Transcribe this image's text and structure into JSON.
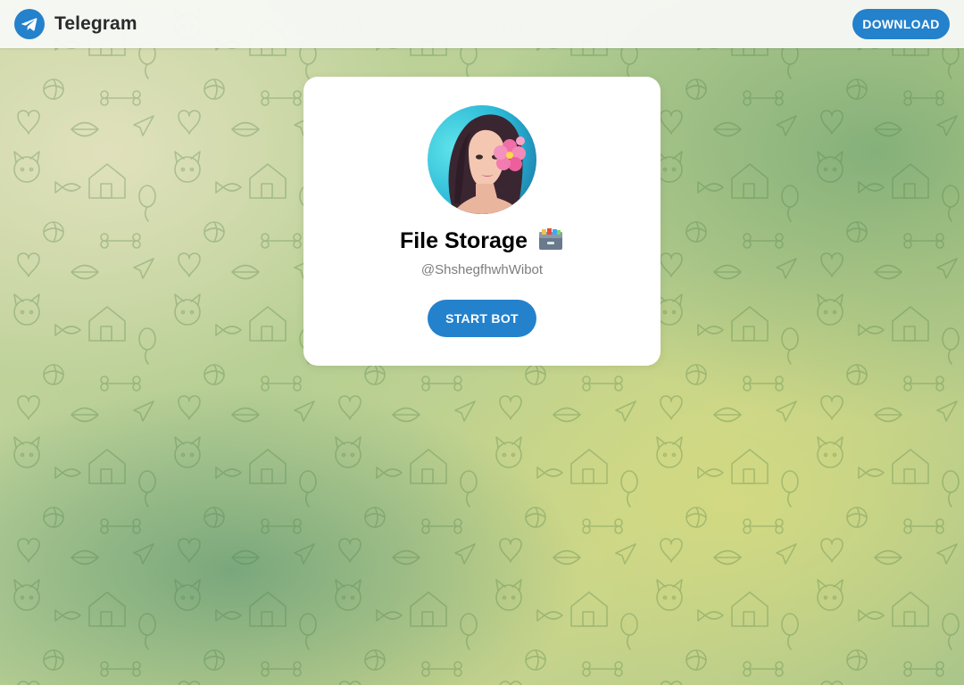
{
  "header": {
    "app_name": "Telegram",
    "download_label": "DOWNLOAD",
    "logo_icon": "telegram-paper-plane-icon"
  },
  "bot": {
    "name": "File Storage",
    "name_icon": "card-file-box-icon",
    "username": "@ShshegfhwhWibot",
    "start_label": "START BOT",
    "avatar_icon": "bot-avatar"
  },
  "colors": {
    "accent": "#2481cc",
    "card_bg": "#ffffff",
    "username": "#7d7d7d"
  }
}
